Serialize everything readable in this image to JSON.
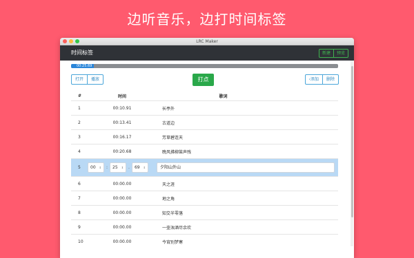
{
  "banner": {
    "headline": "边听音乐，边打时间标签"
  },
  "window": {
    "title": "LRC Maker"
  },
  "appbar": {
    "title": "时间标签",
    "new_label": "新建",
    "preview_label": "预览"
  },
  "progress": {
    "time_text": "00:25.69",
    "fraction": 0.085
  },
  "toolbar": {
    "open_label": "打开",
    "play_label": "播放",
    "mark_label": "打点",
    "add_label": "‹添加",
    "delete_label": "删除"
  },
  "table": {
    "headers": {
      "index": "#",
      "time": "时间",
      "lyric": "歌词"
    },
    "rows": [
      {
        "index": "1",
        "time": "00:10.91",
        "lyric": "长亭外"
      },
      {
        "index": "2",
        "time": "00:13.41",
        "lyric": "古道边"
      },
      {
        "index": "3",
        "time": "00:16.17",
        "lyric": "芳草碧连天"
      },
      {
        "index": "4",
        "time": "00:20.68",
        "lyric": "晚风拂柳笛声残"
      },
      {
        "index": "5",
        "min": "00",
        "sec": "25",
        "ms": "69",
        "lyric": "夕阳山外山"
      },
      {
        "index": "6",
        "time": "00:00.00",
        "lyric": "天之涯"
      },
      {
        "index": "7",
        "time": "00:00.00",
        "lyric": "地之角"
      },
      {
        "index": "8",
        "time": "00:00.00",
        "lyric": "知交半零落"
      },
      {
        "index": "9",
        "time": "00:00.00",
        "lyric": "一壶浊酒尽余欢"
      },
      {
        "index": "10",
        "time": "00:00.00",
        "lyric": "今宵别梦寒"
      }
    ]
  },
  "icons": {
    "spinner_arrow": "updown-arrow-icon"
  }
}
